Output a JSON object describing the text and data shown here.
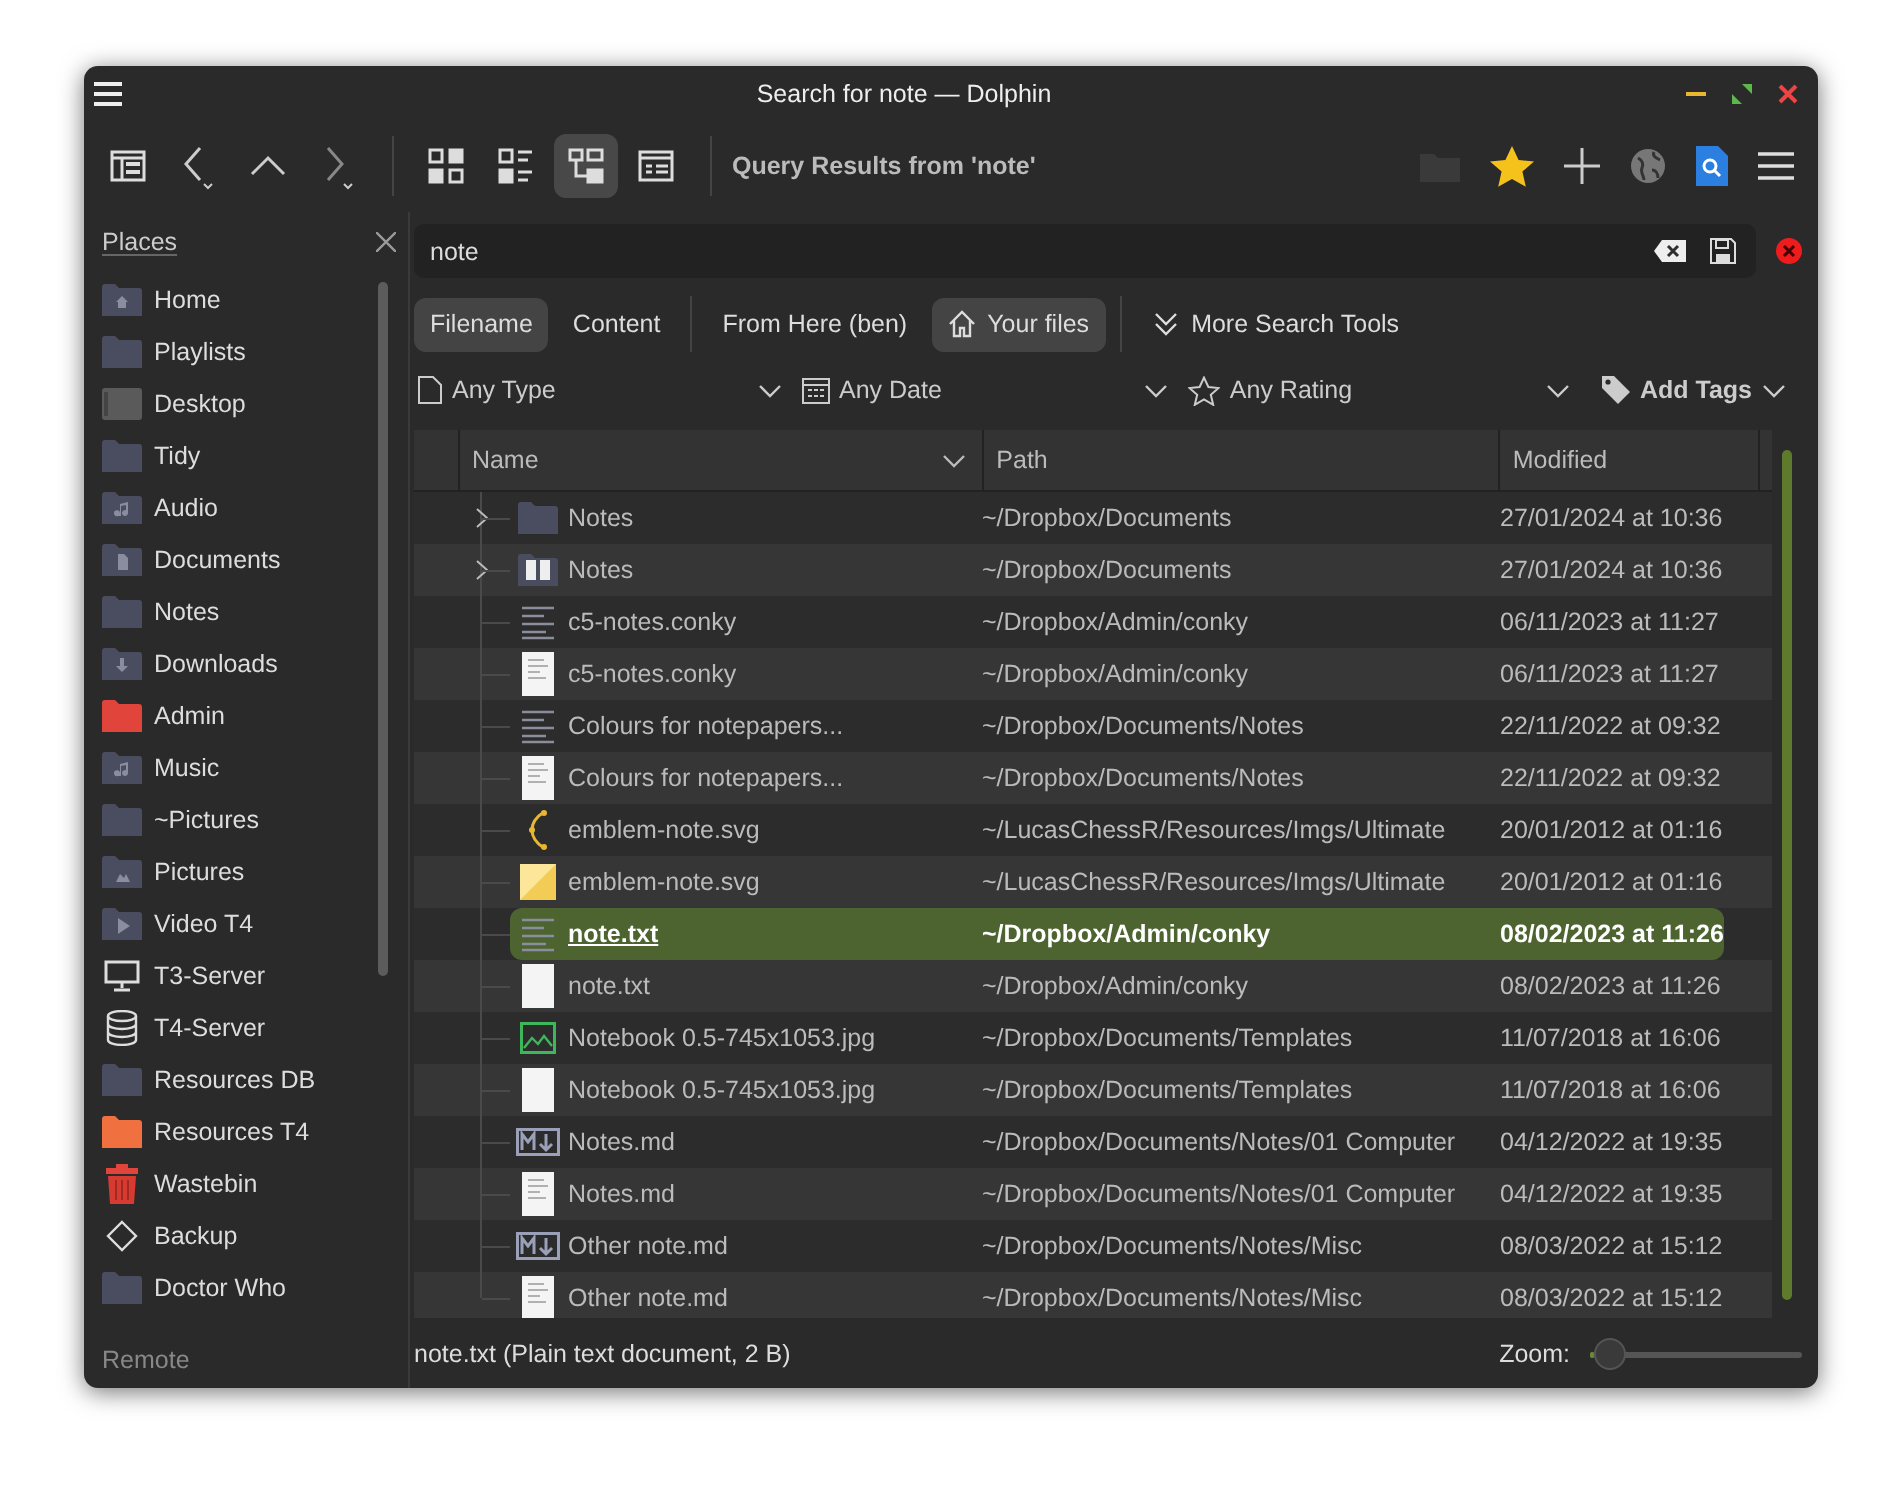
{
  "window": {
    "title": "Search for note — Dolphin"
  },
  "toolbar": {
    "view_modes": [
      {
        "kind": "icons",
        "selected": false
      },
      {
        "kind": "compact",
        "selected": false
      },
      {
        "kind": "details",
        "selected": true
      }
    ],
    "location": "Query Results from 'note'"
  },
  "places": {
    "title": "Places",
    "items": [
      {
        "label": "Home",
        "kind": "home"
      },
      {
        "label": "Playlists",
        "kind": "folder"
      },
      {
        "label": "Desktop",
        "kind": "desktop"
      },
      {
        "label": "Tidy",
        "kind": "folder"
      },
      {
        "label": "Audio",
        "kind": "music"
      },
      {
        "label": "Documents",
        "kind": "documents"
      },
      {
        "label": "Notes",
        "kind": "folder"
      },
      {
        "label": "Downloads",
        "kind": "downloads"
      },
      {
        "label": "Admin",
        "kind": "red"
      },
      {
        "label": "Music",
        "kind": "music"
      },
      {
        "label": "~Pictures",
        "kind": "folder"
      },
      {
        "label": "Pictures",
        "kind": "pictures"
      },
      {
        "label": "Video T4",
        "kind": "video"
      },
      {
        "label": "T3-Server",
        "kind": "monitor"
      },
      {
        "label": "T4-Server",
        "kind": "database"
      },
      {
        "label": "Resources DB",
        "kind": "folder"
      },
      {
        "label": "Resources T4",
        "kind": "orange"
      },
      {
        "label": "Wastebin",
        "kind": "trash"
      },
      {
        "label": "Backup",
        "kind": "diamond"
      },
      {
        "label": "Doctor Who",
        "kind": "folder"
      }
    ],
    "section": "Remote"
  },
  "search": {
    "value": "note"
  },
  "search_options": [
    {
      "label": "Filename",
      "selected": true
    },
    {
      "label": "Content",
      "selected": false
    },
    {
      "label": "From Here (ben)",
      "selected": false
    },
    {
      "label": "Your files",
      "selected": true
    }
  ],
  "more_tools": "More Search Tools",
  "filters": [
    {
      "label": "Any Type",
      "kind": "type"
    },
    {
      "label": "Any Date",
      "kind": "date"
    },
    {
      "label": "Any Rating",
      "kind": "rating"
    },
    {
      "label": "Add Tags",
      "kind": "tags"
    }
  ],
  "table": {
    "columns": [
      "Name",
      "Path",
      "Modified"
    ],
    "rows": [
      {
        "name": "Notes",
        "path": "~/Dropbox/Documents",
        "modified": "27/01/2024 at 10:36",
        "kind": "folder",
        "expandable": true,
        "selected": false
      },
      {
        "name": "Notes",
        "path": "~/Dropbox/Documents",
        "modified": "27/01/2024 at 10:36",
        "kind": "folderpreview",
        "expandable": true,
        "selected": false
      },
      {
        "name": "c5-notes.conky",
        "path": "~/Dropbox/Admin/conky",
        "modified": "06/11/2023 at 11:27",
        "kind": "text",
        "expandable": false,
        "selected": false
      },
      {
        "name": "c5-notes.conky",
        "path": "~/Dropbox/Admin/conky",
        "modified": "06/11/2023 at 11:27",
        "kind": "thumbnail",
        "expandable": false,
        "selected": false
      },
      {
        "name": "Colours for notepapers...",
        "path": "~/Dropbox/Documents/Notes",
        "modified": "22/11/2022 at 09:32",
        "kind": "text",
        "expandable": false,
        "selected": false
      },
      {
        "name": "Colours for notepapers...",
        "path": "~/Dropbox/Documents/Notes",
        "modified": "22/11/2022 at 09:32",
        "kind": "thumbnail",
        "expandable": false,
        "selected": false
      },
      {
        "name": "emblem-note.svg",
        "path": "~/LucasChessR/Resources/Imgs/Ultimate",
        "modified": "20/01/2012 at 01:16",
        "kind": "vector",
        "expandable": false,
        "selected": false
      },
      {
        "name": "emblem-note.svg",
        "path": "~/LucasChessR/Resources/Imgs/Ultimate",
        "modified": "20/01/2012 at 01:16",
        "kind": "sticker",
        "expandable": false,
        "selected": false
      },
      {
        "name": "note.txt",
        "path": "~/Dropbox/Admin/conky",
        "modified": "08/02/2023 at 11:26",
        "kind": "text",
        "expandable": false,
        "selected": true
      },
      {
        "name": "note.txt",
        "path": "~/Dropbox/Admin/conky",
        "modified": "08/02/2023 at 11:26",
        "kind": "blank",
        "expandable": false,
        "selected": false
      },
      {
        "name": "Notebook 0.5-745x1053.jpg",
        "path": "~/Dropbox/Documents/Templates",
        "modified": "11/07/2018 at 16:06",
        "kind": "image",
        "expandable": false,
        "selected": false
      },
      {
        "name": "Notebook 0.5-745x1053.jpg",
        "path": "~/Dropbox/Documents/Templates",
        "modified": "11/07/2018 at 16:06",
        "kind": "blank",
        "expandable": false,
        "selected": false
      },
      {
        "name": "Notes.md",
        "path": "~/Dropbox/Documents/Notes/01 Computer",
        "modified": "04/12/2022 at 19:35",
        "kind": "markdown",
        "expandable": false,
        "selected": false
      },
      {
        "name": "Notes.md",
        "path": "~/Dropbox/Documents/Notes/01 Computer",
        "modified": "04/12/2022 at 19:35",
        "kind": "thumbnail",
        "expandable": false,
        "selected": false
      },
      {
        "name": "Other note.md",
        "path": "~/Dropbox/Documents/Notes/Misc",
        "modified": "08/03/2022 at 15:12",
        "kind": "markdown",
        "expandable": false,
        "selected": false
      },
      {
        "name": "Other note.md",
        "path": "~/Dropbox/Documents/Notes/Misc",
        "modified": "08/03/2022 at 15:12",
        "kind": "thumbnail",
        "expandable": false,
        "selected": false
      }
    ]
  },
  "status_bar": {
    "text": "note.txt (Plain text document, 2 B)",
    "zoom_label": "Zoom:",
    "zoom": {
      "level": 0.02
    }
  }
}
